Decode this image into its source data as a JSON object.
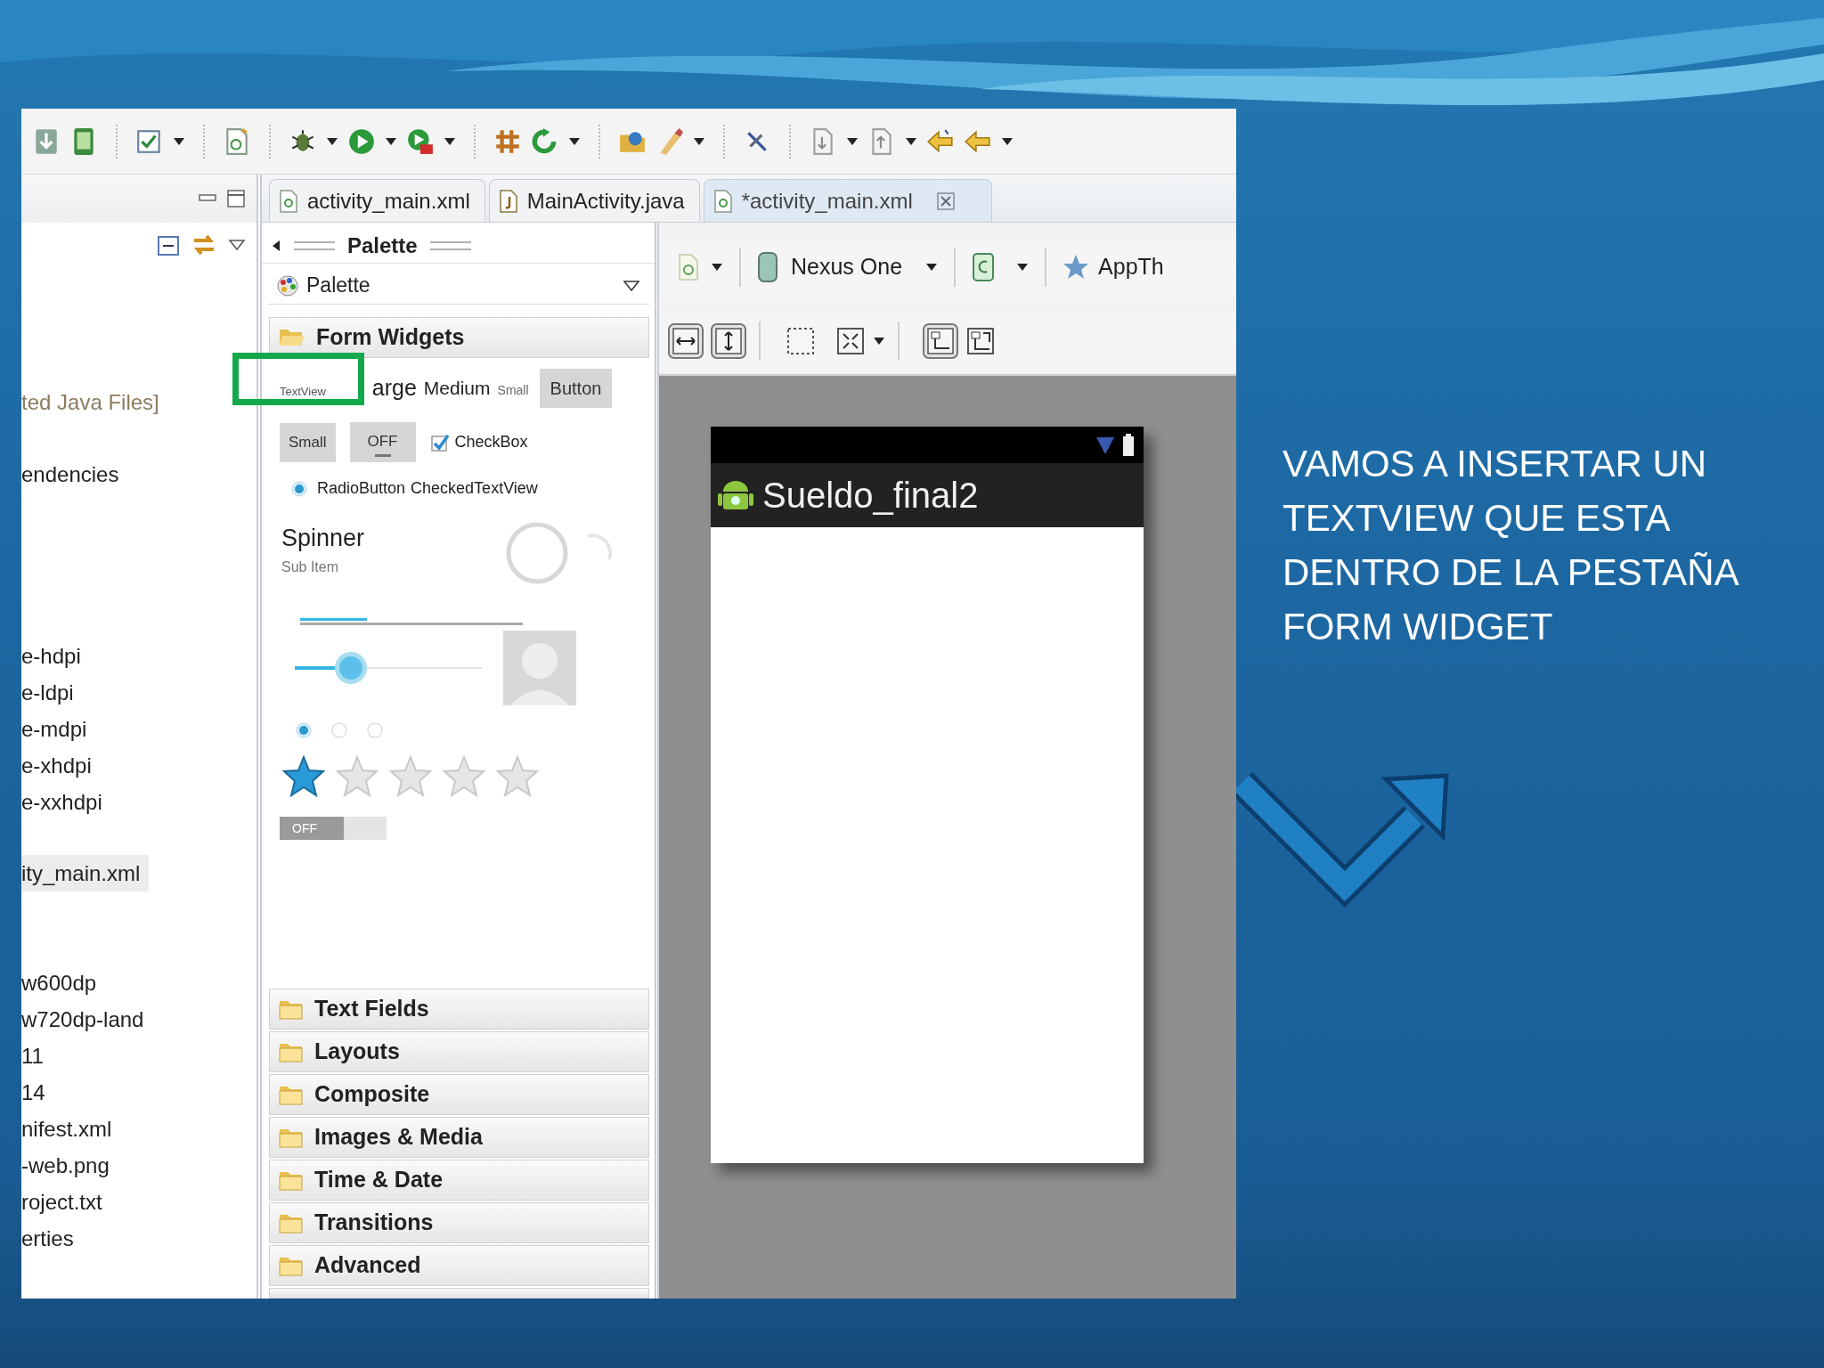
{
  "caption": {
    "lines": [
      "VAMOS A INSERTAR UN",
      "TEXTVIEW QUE ESTA",
      "DENTRO DE LA PESTAÑA",
      "FORM WIDGET"
    ]
  },
  "project_explorer": {
    "groups": [
      [
        {
          "label": "ted Java Files]",
          "kind": "container",
          "selected": false
        }
      ],
      [
        {
          "label": "endencies",
          "kind": "file",
          "selected": false
        }
      ],
      [
        {
          "label": "e-hdpi",
          "kind": "file",
          "selected": false
        },
        {
          "label": "e-ldpi",
          "kind": "file",
          "selected": false
        },
        {
          "label": "e-mdpi",
          "kind": "file",
          "selected": false
        },
        {
          "label": "e-xhdpi",
          "kind": "file",
          "selected": false
        },
        {
          "label": "e-xxhdpi",
          "kind": "file",
          "selected": false
        }
      ],
      [
        {
          "label": "ity_main.xml",
          "kind": "file",
          "selected": true
        }
      ],
      [
        {
          "label": "w600dp",
          "kind": "file",
          "selected": false
        },
        {
          "label": "w720dp-land",
          "kind": "file",
          "selected": false
        },
        {
          "label": "11",
          "kind": "file",
          "selected": false
        },
        {
          "label": "14",
          "kind": "file",
          "selected": false
        },
        {
          "label": "nifest.xml",
          "kind": "file",
          "selected": false
        },
        {
          "label": "-web.png",
          "kind": "file",
          "selected": false
        },
        {
          "label": "roject.txt",
          "kind": "file",
          "selected": false
        },
        {
          "label": "erties",
          "kind": "file",
          "selected": false
        }
      ]
    ]
  },
  "editor_tabs": [
    {
      "label": "activity_main.xml",
      "kind": "xml",
      "selected": false
    },
    {
      "label": "MainActivity.java",
      "kind": "java",
      "selected": false
    },
    {
      "label": "*activity_main.xml",
      "kind": "xml",
      "selected": true
    }
  ],
  "palette": {
    "title": "Palette",
    "selector": "Palette",
    "open_category": "Form Widgets",
    "widgets": {
      "textview": "TextView",
      "large": "arge",
      "medium": "Medium",
      "small": "Small",
      "button": "Button",
      "small_button": "Small",
      "toggle": {
        "label": "OFF",
        "on": false
      },
      "checkbox": {
        "label": "CheckBox",
        "checked": true
      },
      "radio": {
        "label": "RadioButton",
        "checked": true
      },
      "checked_text_view": "CheckedTextView",
      "spinner": {
        "label": "Spinner",
        "sub": "Sub Item"
      },
      "progress": {
        "level": 0.3
      },
      "seekbar": {
        "level": 0.3
      },
      "radio_group": [
        {
          "selected": true
        },
        {
          "selected": false
        },
        {
          "selected": false
        }
      ],
      "rating": {
        "stars": 1
      },
      "switch": {
        "label": "OFF",
        "on": false
      }
    },
    "categories": [
      "Text Fields",
      "Layouts",
      "Composite",
      "Images & Media",
      "Time & Date",
      "Transitions",
      "Advanced"
    ]
  },
  "layout_editor": {
    "device": "Nexus One",
    "theme": "AppTh",
    "app_title": "Sueldo_final2"
  }
}
